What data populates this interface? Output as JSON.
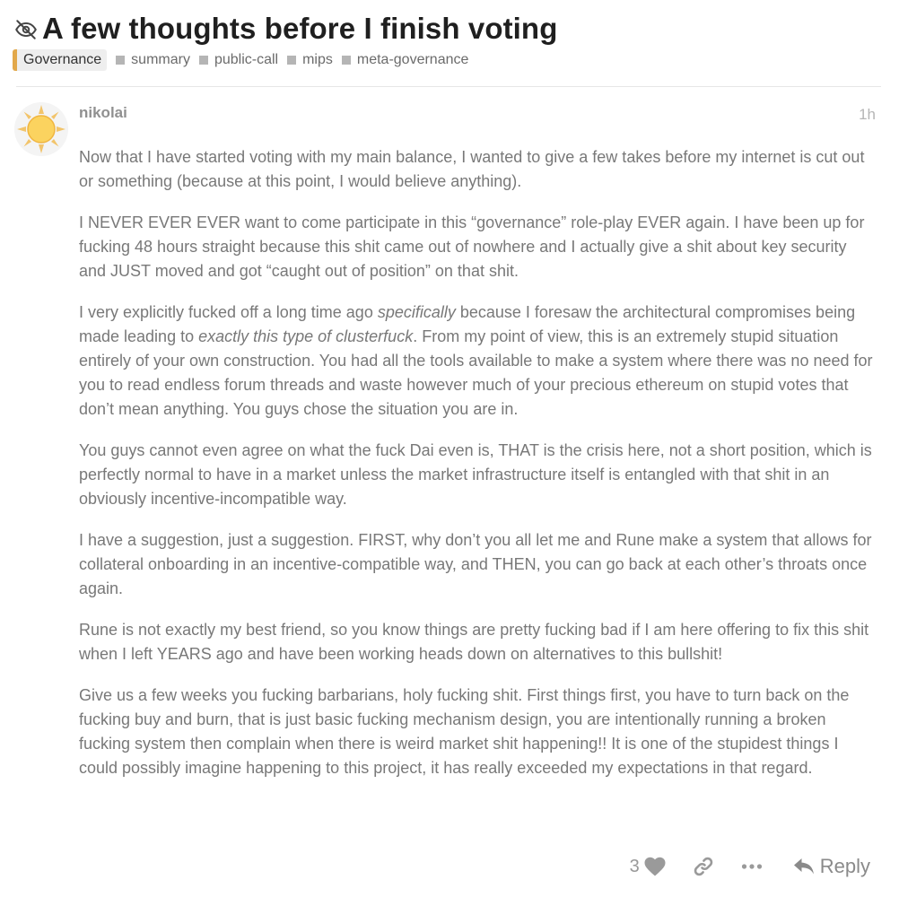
{
  "topic": {
    "unlisted_icon": "eye-slash-icon",
    "title": "A few thoughts before I finish voting",
    "category": {
      "name": "Governance",
      "color": "#e2a84a"
    },
    "tags": [
      "summary",
      "public-call",
      "mips",
      "meta-governance"
    ]
  },
  "post": {
    "avatar_icon": "sun-avatar",
    "username": "nikolai",
    "date": "1h",
    "paragraphs": [
      [
        {
          "text": "Now that I have started voting with my main balance, I wanted to give a few takes before my internet is cut out or something (because at this point, I would believe anything)."
        }
      ],
      [
        {
          "text": "I NEVER EVER EVER want to come participate in this “governance” role-play EVER again. I have been up for fucking 48 hours straight because this shit came out of nowhere and I actually give a shit about key security and JUST moved and got “caught out of position” on that shit."
        }
      ],
      [
        {
          "text": "I very explicitly fucked off a long time ago "
        },
        {
          "text": "specifically",
          "italic": true
        },
        {
          "text": " because I foresaw the architectural compromises being made leading to "
        },
        {
          "text": "exactly this type of clusterfuck",
          "italic": true
        },
        {
          "text": ". From my point of view, this is an extremely stupid situation entirely of your own construction. You had all the tools available to make a system where there was no need for you to read endless forum threads and waste however much of your precious ethereum on stupid votes that don’t mean anything. You guys chose the situation you are in."
        }
      ],
      [
        {
          "text": "You guys cannot even agree on what the fuck Dai even is, THAT is the crisis here, not a short position, which is perfectly normal to have in a market unless the market infrastructure itself is entangled with that shit in an obviously incentive-incompatible way."
        }
      ],
      [
        {
          "text": "I have a suggestion, just a suggestion. FIRST, why don’t you all let me and Rune make a system that allows for collateral onboarding in an incentive-compatible way, and THEN, you can go back at each other’s throats once again."
        }
      ],
      [
        {
          "text": "Rune is not exactly my best friend, so you know things are pretty fucking bad if I am here offering to fix this shit when I left YEARS ago and have been working heads down on alternatives to this bullshit!"
        }
      ],
      [
        {
          "text": "Give us a few weeks you fucking barbarians, holy fucking shit. First things first, you have to turn back on the fucking buy and burn, that is just basic fucking mechanism design, you are intentionally running a broken fucking system then complain when there is weird market shit happening!! It is one of the stupidest things I could possibly imagine happening to this project, it has really exceeded my expectations in that regard."
        }
      ]
    ],
    "actions": {
      "like_count": "3",
      "like_icon": "heart-icon",
      "link_icon": "link-icon",
      "more_icon": "ellipsis-icon",
      "reply_icon": "reply-icon",
      "reply_label": "Reply"
    }
  }
}
